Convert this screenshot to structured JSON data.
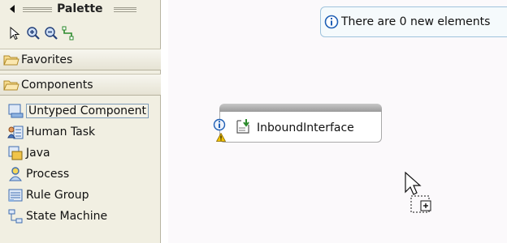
{
  "palette": {
    "title": "Palette",
    "tools": [
      {
        "name": "select-tool-icon"
      },
      {
        "name": "zoom-in-icon"
      },
      {
        "name": "zoom-out-icon"
      },
      {
        "name": "wire-tool-icon"
      }
    ],
    "drawers": [
      {
        "label": "Favorites"
      },
      {
        "label": "Components"
      }
    ],
    "entries": [
      {
        "label": "Untyped Component",
        "icon": "untyped-component-icon"
      },
      {
        "label": "Human Task",
        "icon": "human-task-icon"
      },
      {
        "label": "Java",
        "icon": "java-icon"
      },
      {
        "label": "Process",
        "icon": "process-icon"
      },
      {
        "label": "Rule Group",
        "icon": "rule-group-icon"
      },
      {
        "label": "State Machine",
        "icon": "state-machine-icon"
      }
    ]
  },
  "canvas": {
    "info_banner": "There are 0 new elements",
    "component": {
      "label": "InboundInterface"
    }
  },
  "colors": {
    "palette_bg": "#f1efe2",
    "canvas_bg": "#fbf9fb",
    "banner_border": "#9fc3dc",
    "info_blue": "#1f5fb5",
    "warning_yellow": "#f2c200"
  }
}
